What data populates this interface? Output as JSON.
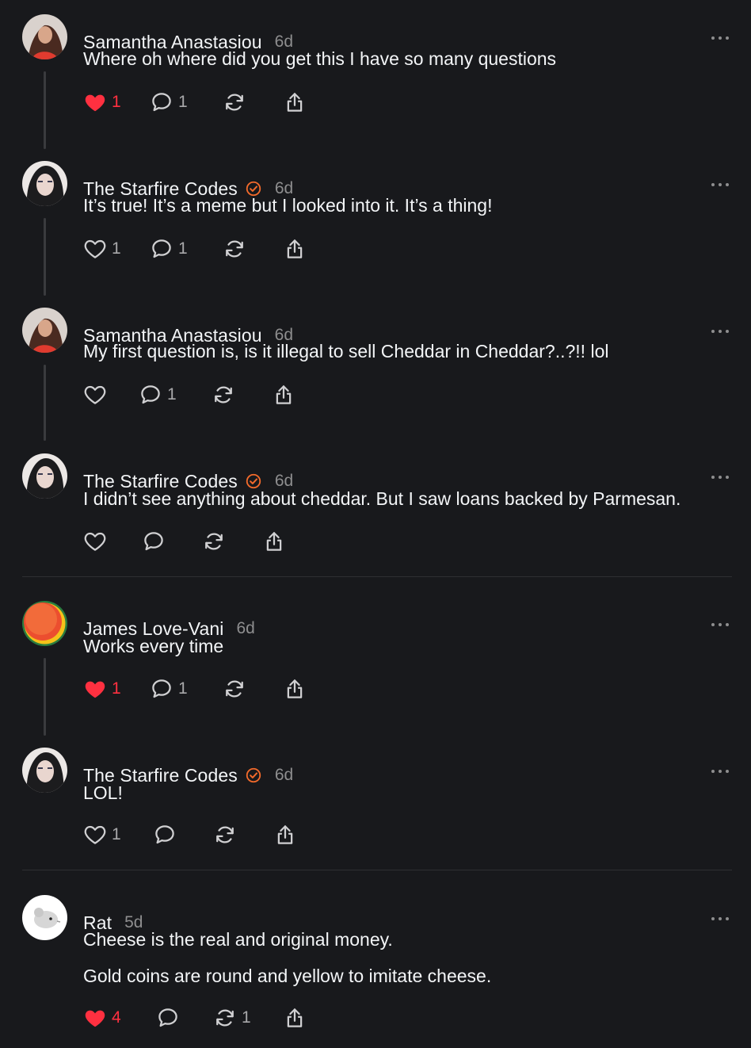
{
  "colors": {
    "background": "#18191c",
    "text": "#f3f5f7",
    "muted": "#8e8e8f",
    "like": "#ff3040",
    "verified": "#f26a2b"
  },
  "icons": {
    "like": "heart-icon",
    "reply": "comment-bubble-icon",
    "repost": "repost-icon",
    "share": "share-icon",
    "more": "more-dots-icon",
    "verified": "verified-badge-icon"
  },
  "posts": [
    {
      "author": "Samantha Anastasiou",
      "time": "6d",
      "verified": false,
      "lines": [
        "Where oh where did you get this I have so many questions"
      ],
      "liked": true,
      "likes": "1",
      "replies": "1",
      "reposts": ""
    },
    {
      "author": "The Starfire Codes",
      "time": "6d",
      "verified": true,
      "lines": [
        "It’s true! It’s a meme but I looked into it. It’s a thing!"
      ],
      "liked": false,
      "likes": "1",
      "replies": "1",
      "reposts": ""
    },
    {
      "author": "Samantha Anastasiou",
      "time": "6d",
      "verified": false,
      "lines": [
        "My first question is, is it illegal to sell Cheddar in Cheddar?..?!! lol"
      ],
      "liked": false,
      "likes": "",
      "replies": "1",
      "reposts": ""
    },
    {
      "author": "The Starfire Codes",
      "time": "6d",
      "verified": true,
      "lines": [
        "I didn’t see anything about cheddar. But I saw loans backed by Parmesan."
      ],
      "liked": false,
      "likes": "",
      "replies": "",
      "reposts": ""
    },
    {
      "author": "James Love-Vani",
      "time": "6d",
      "verified": false,
      "lines": [
        "Works every time"
      ],
      "liked": true,
      "likes": "1",
      "replies": "1",
      "reposts": ""
    },
    {
      "author": "The Starfire Codes",
      "time": "6d",
      "verified": true,
      "lines": [
        "LOL!"
      ],
      "liked": false,
      "likes": "1",
      "replies": "",
      "reposts": ""
    },
    {
      "author": "Rat",
      "time": "5d",
      "verified": false,
      "lines": [
        "Cheese is the real and original money.",
        "Gold coins are round and yellow to imitate cheese."
      ],
      "liked": true,
      "likes": "4",
      "replies": "",
      "reposts": "1"
    }
  ]
}
